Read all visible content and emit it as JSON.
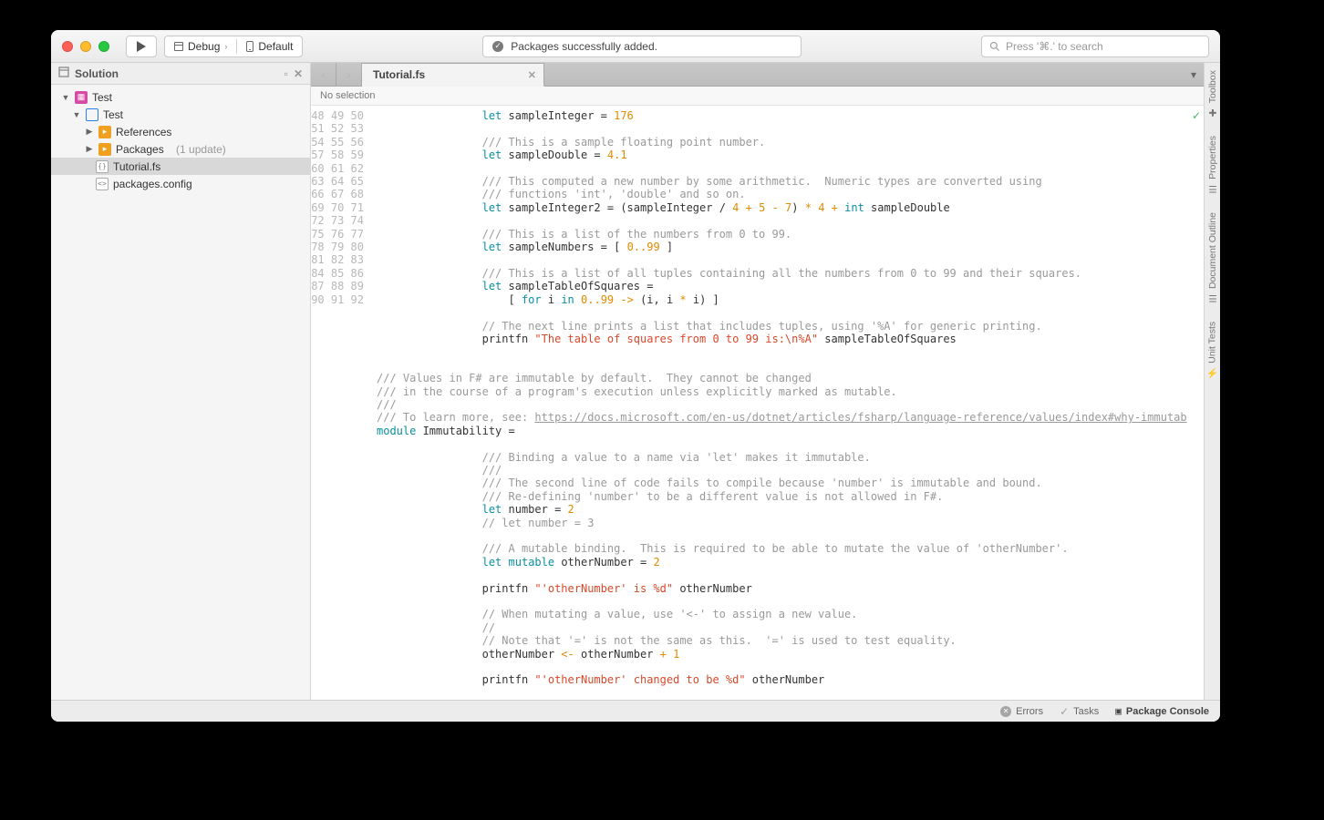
{
  "toolbar": {
    "config": "Debug",
    "target": "Default",
    "status": "Packages successfully added.",
    "search_placeholder": "Press '⌘.' to search"
  },
  "sidebar": {
    "title": "Solution",
    "root": "Test",
    "project": "Test",
    "references": "References",
    "packages": "Packages",
    "packages_suffix": "(1 update)",
    "file1": "Tutorial.fs",
    "file2": "packages.config"
  },
  "tabs": {
    "active": "Tutorial.fs"
  },
  "breadcrumb": "No selection",
  "right_rail": [
    "Toolbox",
    "Properties",
    "Document Outline",
    "Unit Tests"
  ],
  "status": {
    "errors": "Errors",
    "tasks": "Tasks",
    "console": "Package Console"
  },
  "code": {
    "first_line": 48,
    "lines": [
      [
        [
          "kw",
          "let"
        ],
        [
          "",
          " sampleInteger = "
        ],
        [
          "num",
          "176"
        ]
      ],
      [],
      [
        [
          "com",
          "/// This is a sample floating point number."
        ]
      ],
      [
        [
          "kw",
          "let"
        ],
        [
          "",
          " sampleDouble = "
        ],
        [
          "num",
          "4.1"
        ]
      ],
      [],
      [
        [
          "com",
          "/// This computed a new number by some arithmetic.  Numeric types are converted using"
        ]
      ],
      [
        [
          "com",
          "/// functions 'int', 'double' and so on."
        ]
      ],
      [
        [
          "kw",
          "let"
        ],
        [
          "",
          " sampleInteger2 = (sampleInteger / "
        ],
        [
          "num",
          "4"
        ],
        [
          "",
          " "
        ],
        [
          "op",
          "+"
        ],
        [
          "",
          " "
        ],
        [
          "num",
          "5"
        ],
        [
          "",
          " "
        ],
        [
          "op",
          "-"
        ],
        [
          "",
          " "
        ],
        [
          "num",
          "7"
        ],
        [
          "",
          ") "
        ],
        [
          "op",
          "*"
        ],
        [
          "",
          " "
        ],
        [
          "num",
          "4"
        ],
        [
          "",
          " "
        ],
        [
          "op",
          "+"
        ],
        [
          "",
          " "
        ],
        [
          "kw",
          "int"
        ],
        [
          "",
          " sampleDouble"
        ]
      ],
      [],
      [
        [
          "com",
          "/// This is a list of the numbers from 0 to 99."
        ]
      ],
      [
        [
          "kw",
          "let"
        ],
        [
          "",
          " sampleNumbers = [ "
        ],
        [
          "num",
          "0"
        ],
        [
          "op",
          ".."
        ],
        [
          "num",
          "99"
        ],
        [
          "",
          " ]"
        ]
      ],
      [],
      [
        [
          "com",
          "/// This is a list of all tuples containing all the numbers from 0 to 99 and their squares."
        ]
      ],
      [
        [
          "kw",
          "let"
        ],
        [
          "",
          " sampleTableOfSquares ="
        ]
      ],
      [
        [
          "",
          "    [ "
        ],
        [
          "kw",
          "for"
        ],
        [
          "",
          " i "
        ],
        [
          "kw",
          "in"
        ],
        [
          "",
          " "
        ],
        [
          "num",
          "0"
        ],
        [
          "op",
          ".."
        ],
        [
          "num",
          "99"
        ],
        [
          "",
          " "
        ],
        [
          "op",
          "->"
        ],
        [
          "",
          " (i, i "
        ],
        [
          "op",
          "*"
        ],
        [
          "",
          " i) ]"
        ]
      ],
      [],
      [
        [
          "com",
          "// The next line prints a list that includes tuples, using '%A' for generic printing."
        ]
      ],
      [
        [
          "",
          "printfn "
        ],
        [
          "str",
          "\"The table of squares from 0 to 99 is:\\n%A\""
        ],
        [
          "",
          " sampleTableOfSquares"
        ]
      ],
      [],
      [],
      [
        [
          "com",
          "/// Values in F# are immutable by default.  They cannot be changed"
        ]
      ],
      [
        [
          "com",
          "/// in the course of a program's execution unless explicitly marked as mutable."
        ]
      ],
      [
        [
          "com",
          "///"
        ]
      ],
      [
        [
          "com",
          "/// To learn more, see: "
        ],
        [
          "comlink",
          "https://docs.microsoft.com/en-us/dotnet/articles/fsharp/language-reference/values/index#why-immutab"
        ]
      ],
      [
        [
          "kw",
          "module"
        ],
        [
          "",
          " Immutability ="
        ]
      ],
      [],
      [
        [
          "com",
          "/// Binding a value to a name via 'let' makes it immutable."
        ]
      ],
      [
        [
          "com",
          "///"
        ]
      ],
      [
        [
          "com",
          "/// The second line of code fails to compile because 'number' is immutable and bound."
        ]
      ],
      [
        [
          "com",
          "/// Re-defining 'number' to be a different value is not allowed in F#."
        ]
      ],
      [
        [
          "kw",
          "let"
        ],
        [
          "",
          " number = "
        ],
        [
          "num",
          "2"
        ]
      ],
      [
        [
          "com",
          "// let number = 3"
        ]
      ],
      [],
      [
        [
          "com",
          "/// A mutable binding.  This is required to be able to mutate the value of 'otherNumber'."
        ]
      ],
      [
        [
          "kw",
          "let"
        ],
        [
          "",
          " "
        ],
        [
          "kw",
          "mutable"
        ],
        [
          "",
          " otherNumber = "
        ],
        [
          "num",
          "2"
        ]
      ],
      [],
      [
        [
          "",
          "printfn "
        ],
        [
          "str",
          "\"'otherNumber' is %d\""
        ],
        [
          "",
          " otherNumber"
        ]
      ],
      [],
      [
        [
          "com",
          "// When mutating a value, use '<-' to assign a new value."
        ]
      ],
      [
        [
          "com",
          "//"
        ]
      ],
      [
        [
          "com",
          "// Note that '=' is not the same as this.  '=' is used to test equality."
        ]
      ],
      [
        [
          "",
          "otherNumber "
        ],
        [
          "op",
          "<-"
        ],
        [
          "",
          " otherNumber "
        ],
        [
          "op",
          "+"
        ],
        [
          "",
          " "
        ],
        [
          "num",
          "1"
        ]
      ],
      [],
      [
        [
          "",
          "printfn "
        ],
        [
          "str",
          "\"'otherNumber' changed to be %d\""
        ],
        [
          "",
          " otherNumber"
        ]
      ],
      []
    ],
    "indents": [
      4,
      4,
      4,
      4,
      4,
      4,
      4,
      4,
      4,
      4,
      4,
      4,
      4,
      4,
      4,
      4,
      4,
      4,
      4,
      4,
      0,
      0,
      0,
      0,
      0,
      0,
      4,
      4,
      4,
      4,
      4,
      4,
      4,
      4,
      4,
      4,
      4,
      4,
      4,
      4,
      4,
      4,
      4,
      4,
      4
    ]
  }
}
